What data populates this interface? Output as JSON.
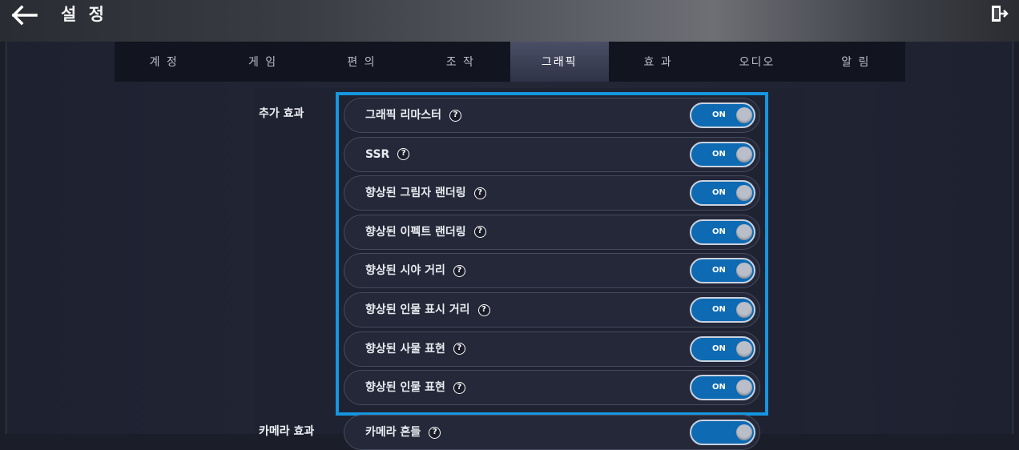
{
  "header": {
    "title": "설 정",
    "back_icon": "arrow-left-icon",
    "exit_icon": "exit-door-icon"
  },
  "tabs": [
    {
      "label": "계 정",
      "active": false
    },
    {
      "label": "게 임",
      "active": false
    },
    {
      "label": "편 의",
      "active": false
    },
    {
      "label": "조 작",
      "active": false
    },
    {
      "label": "그래픽",
      "active": true
    },
    {
      "label": "효 과",
      "active": false
    },
    {
      "label": "오디오",
      "active": false
    },
    {
      "label": "알 림",
      "active": false
    }
  ],
  "section": {
    "label": "추가 효과",
    "items": [
      {
        "label": "그래픽 리마스터",
        "toggle": "ON"
      },
      {
        "label": "SSR",
        "toggle": "ON"
      },
      {
        "label": "향상된 그림자 랜더링",
        "toggle": "ON"
      },
      {
        "label": "향상된 이펙트 랜더링",
        "toggle": "ON"
      },
      {
        "label": "향상된 시야 거리",
        "toggle": "ON"
      },
      {
        "label": "향상된 인물 표시 거리",
        "toggle": "ON"
      },
      {
        "label": "향상된 사물 표현",
        "toggle": "ON"
      },
      {
        "label": "향상된 인물 표현",
        "toggle": "ON"
      }
    ]
  },
  "next_section": {
    "label": "카메라 효과",
    "first_item": "카메라 흔들"
  },
  "help_glyph": "?",
  "colors": {
    "highlight": "#1596e0",
    "toggle_on": "#0e6ab2",
    "active_tab": "#3a3f57"
  }
}
